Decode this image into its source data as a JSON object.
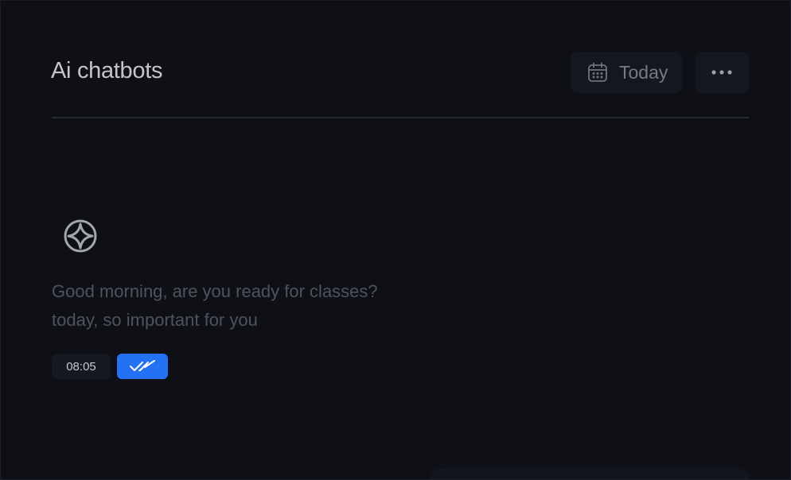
{
  "header": {
    "title": "Ai chatbots",
    "date_filter": {
      "label": "Today",
      "icon": "calendar-icon"
    },
    "more_icon": "more-horizontal-icon"
  },
  "conversation": {
    "messages": [
      {
        "sender_icon": "chatbot-icon",
        "lines": [
          "Good morning, are you ready for classes?",
          "today, so important for you"
        ],
        "time": "08:05",
        "status_icon": "double-check-icon"
      }
    ]
  },
  "colors": {
    "background": "#0e1016",
    "accent": "#2472f3",
    "title_text": "#c3c5cb",
    "muted_text": "#4f535e"
  }
}
